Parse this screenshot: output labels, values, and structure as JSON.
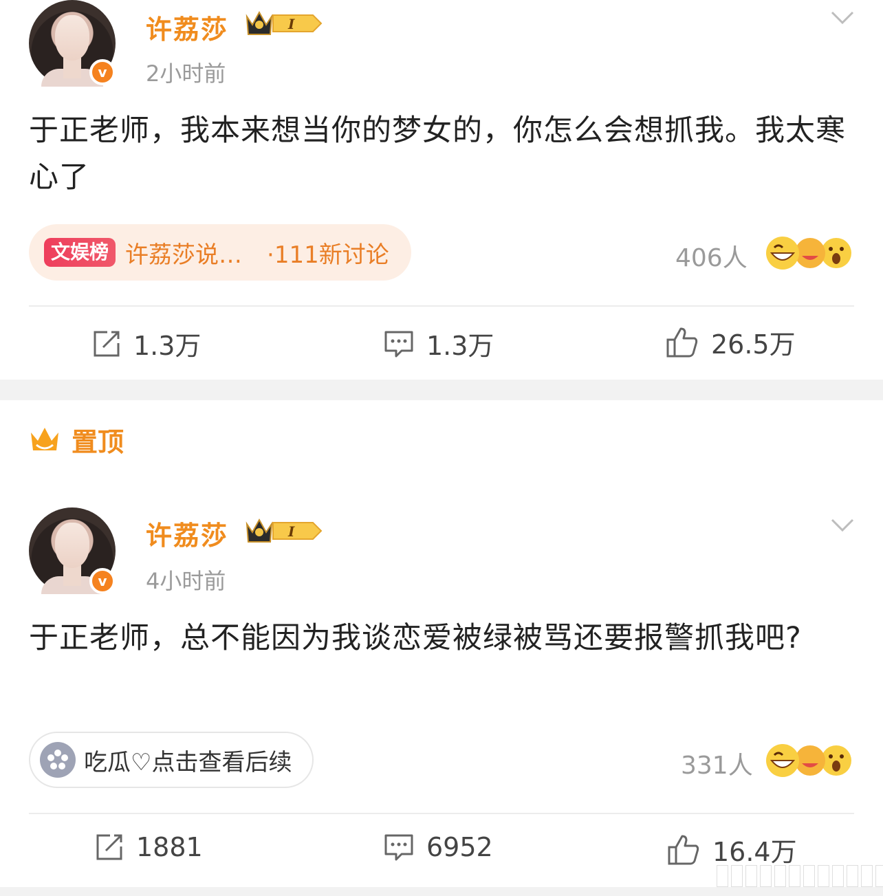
{
  "posts": [
    {
      "author": "许荔莎",
      "level": "I",
      "time": "2小时前",
      "content": "于正老师，我本来想当你的梦女的，你怎么会想抓我。我太寒心了",
      "tag": {
        "logo": "文娱榜",
        "text": "许荔莎说…",
        "count": "·111新讨论"
      },
      "reactions_people": "406人",
      "actions": {
        "repost": "1.3万",
        "comment": "1.3万",
        "like": "26.5万"
      }
    },
    {
      "author": "许荔莎",
      "level": "I",
      "time": "4小时前",
      "content": "于正老师，总不能因为我谈恋爱被绿被骂还要报警抓我吧?",
      "link": "吃瓜♡点击查看后续",
      "reactions_people": "331人",
      "actions": {
        "repost": "1881",
        "comment": "6952",
        "like": "16.4万"
      }
    }
  ],
  "pinned_label": "置顶",
  "icons": {
    "verified": "v-badge-icon",
    "level": "crown-level-badge",
    "more": "chevron-down-icon",
    "repost": "repost-icon",
    "comment": "comment-icon",
    "like": "thumbs-up-icon",
    "pinned": "crown-icon"
  },
  "colors": {
    "accent": "#f08c1e",
    "verified": "#f5821f",
    "tag_pink": "#ee3e5c"
  }
}
